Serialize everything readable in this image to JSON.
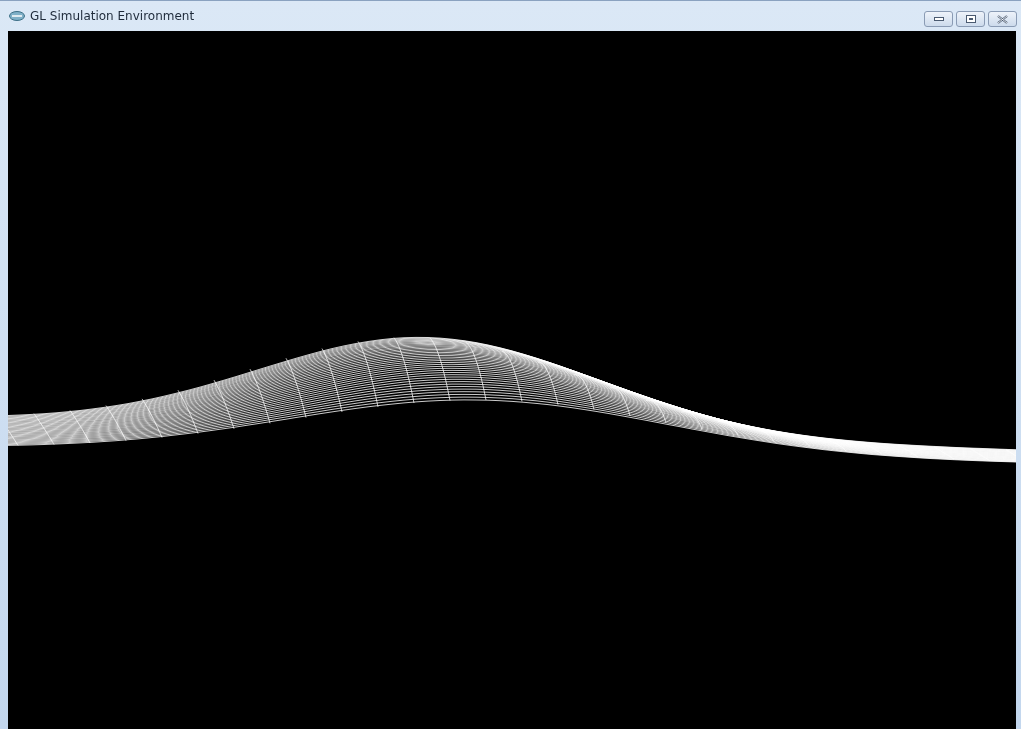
{
  "window": {
    "title": "GL Simulation Environment"
  }
}
